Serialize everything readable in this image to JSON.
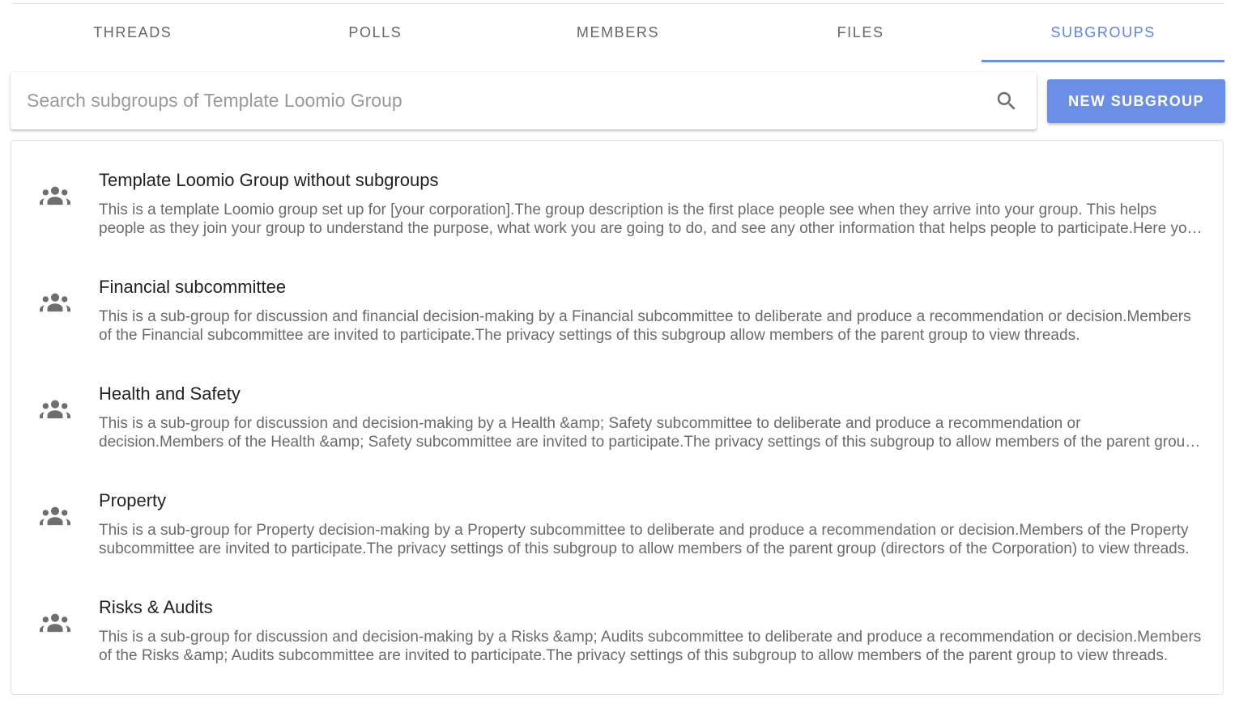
{
  "tabs": [
    {
      "label": "THREADS",
      "active": false
    },
    {
      "label": "POLLS",
      "active": false
    },
    {
      "label": "MEMBERS",
      "active": false
    },
    {
      "label": "FILES",
      "active": false
    },
    {
      "label": "SUBGROUPS",
      "active": true
    }
  ],
  "search": {
    "placeholder": "Search subgroups of Template Loomio Group",
    "value": "",
    "icon": "search-icon"
  },
  "new_subgroup_label": "NEW SUBGROUP",
  "colors": {
    "accent": "#6b8fe6",
    "icon": "#6e6e6e"
  },
  "subgroups": [
    {
      "icon": "group-icon",
      "title": "Template Loomio Group without subgroups",
      "description": "This is a template Loomio group set up for [your corporation].The group description is the first place people see when they arrive into your group. This helps people as they join your group to understand the purpose, what work you are going to do, and see any other information that helps people to participate.Here you can describe the group in more detail."
    },
    {
      "icon": "group-icon",
      "title": "Financial subcommittee",
      "description": "This is a sub-group for discussion and financial decision-making by a Financial subcommittee to deliberate and produce a recommendation or decision.Members of the Financial subcommittee are invited to participate.The privacy settings of this subgroup allow members of the parent group to view threads."
    },
    {
      "icon": "group-icon",
      "title": "Health and Safety",
      "description": "This is a sub-group for discussion and decision-making by a Health &amp; Safety subcommittee to deliberate and produce a recommendation or decision.Members of the Health &amp; Safety subcommittee are invited to participate.The privacy settings of this subgroup to allow members of the parent group to view threads."
    },
    {
      "icon": "group-icon",
      "title": "Property",
      "description": "This is a sub-group for Property decision-making by a Property subcommittee to deliberate and produce a recommendation or decision.Members of the Property subcommittee are invited to participate.The privacy settings of this subgroup to allow members of the parent group (directors of the Corporation) to view threads."
    },
    {
      "icon": "group-icon",
      "title": "Risks & Audits",
      "description": "This is a sub-group for discussion and decision-making by a Risks &amp; Audits subcommittee to deliberate and produce a recommendation or decision.Members of the Risks &amp; Audits subcommittee are invited to participate.The privacy settings of this subgroup to allow members of the parent group to view threads."
    }
  ]
}
